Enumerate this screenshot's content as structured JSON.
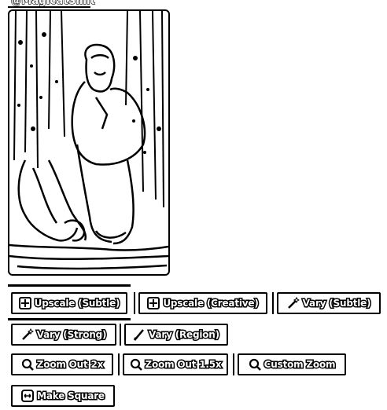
{
  "header": {
    "username": "@MagicatSmit"
  },
  "image": {
    "alt_icon": "generated-image"
  },
  "buttons": {
    "upscale_subtle": "Upscale (Subtle)",
    "upscale_creative": "Upscale (Creative)",
    "vary_subtle": "Vary (Subtle)",
    "vary_strong": "Vary (Strong)",
    "vary_region": "Vary (Region)",
    "zoom_out_2x": "Zoom Out 2x",
    "zoom_out_1_5x": "Zoom Out 1.5x",
    "custom_zoom": "Custom Zoom",
    "make_square": "Make Square"
  },
  "icons": {
    "upscale": "upscale-grid-icon",
    "vary": "magic-wand-icon",
    "region": "brush-icon",
    "zoom": "magnifier-icon",
    "square": "square-arrows-icon"
  }
}
